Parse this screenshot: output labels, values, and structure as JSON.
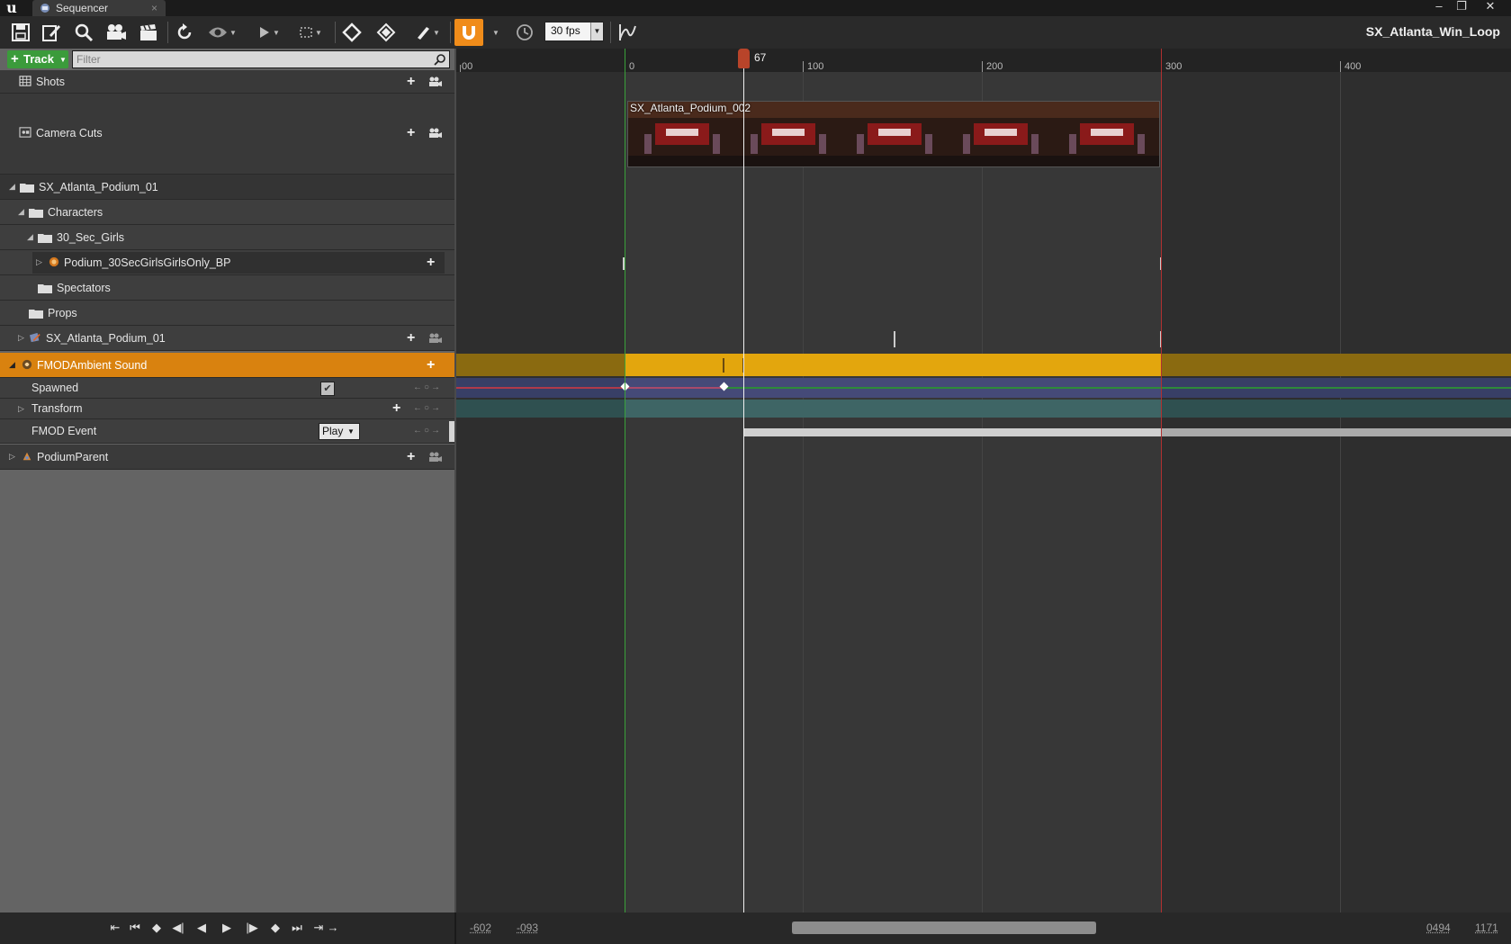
{
  "window": {
    "tab_label": "Sequencer",
    "tab_close": "×",
    "controls": [
      "–",
      "❐",
      "✕"
    ]
  },
  "toolbar": {
    "fps_label": "30 fps",
    "sequence_title": "SX_Atlanta_Win_Loop",
    "icons": [
      "save-icon",
      "edit-icon",
      "search-icon",
      "camera-icon",
      "clapper-icon",
      "refresh-icon",
      "eye-icon",
      "play-options-icon",
      "selection-icon",
      "key-icon",
      "transform-icon",
      "brush-icon",
      "snap-magnet-icon",
      "clock-icon",
      "curve-editor-icon"
    ]
  },
  "left_panel": {
    "track_button": "Track",
    "filter_placeholder": "Filter",
    "rows": [
      {
        "label": "Shots"
      },
      {
        "label": "Camera Cuts"
      },
      {
        "label": "SX_Atlanta_Podium_01"
      },
      {
        "label": "Characters"
      },
      {
        "label": "30_Sec_Girls"
      },
      {
        "label": "Podium_30SecGirlsGirlsOnly_BP"
      },
      {
        "label": "Spectators"
      },
      {
        "label": "Props"
      },
      {
        "label": "SX_Atlanta_Podium_01"
      },
      {
        "label": "FMODAmbient Sound"
      },
      {
        "label": "Spawned",
        "checked": true
      },
      {
        "label": "Transform"
      },
      {
        "label": "FMOD Event",
        "value": "Play"
      },
      {
        "label": "PodiumParent"
      }
    ]
  },
  "timeline": {
    "ruler_labels": [
      "00",
      "0",
      "100",
      "200",
      "300",
      "400"
    ],
    "playhead_frame": "67",
    "shot_name": "SX_Atlanta_Podium_002",
    "colors": {
      "fmod_track": "#e3a60d",
      "selected_row": "#d9820f",
      "in_marker": "#3aa03a",
      "out_marker": "#b03030",
      "playhead": "#b8442a"
    }
  },
  "bottom_bar": {
    "view_start": "-602",
    "working_start": "-093",
    "working_end": "0494",
    "view_end": "1171",
    "playback_icons": [
      "jump-to-start-icon",
      "step-back-key-icon",
      "prev-key-icon",
      "step-back-frame-icon",
      "play-reverse-icon",
      "play-icon",
      "step-forward-frame-icon",
      "next-key-icon",
      "step-forward-key-icon",
      "jump-to-end-icon",
      "loop-icon"
    ]
  }
}
